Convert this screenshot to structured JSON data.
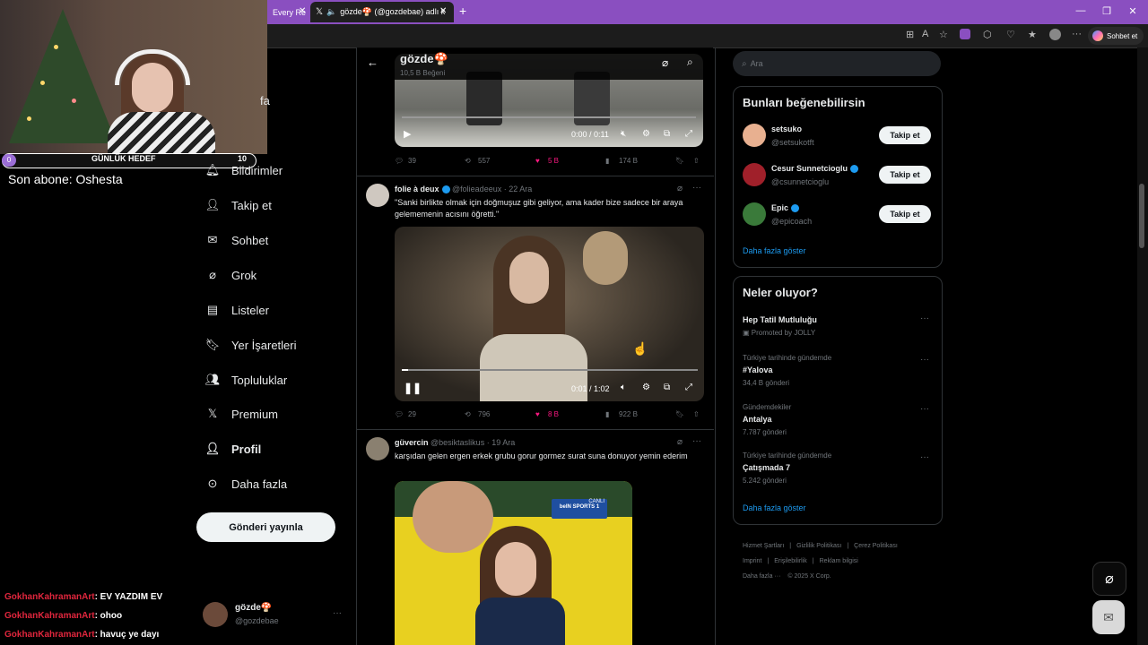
{
  "browser": {
    "tabs": [
      {
        "label": "Every Re"
      },
      {
        "label": "gözde🍄 (@gozdebae) adlı k"
      }
    ],
    "chat_label": "Sohbet et"
  },
  "stream": {
    "goal_title": "GÜNLÜK HEDEF",
    "goal_start": "0",
    "goal_target": "10",
    "last_sub": "Son abone: Oshesta",
    "chat": [
      {
        "user": "GokhanKahramanArt",
        "msg": ": EV YAZDIM EV"
      },
      {
        "user": "GokhanKahramanArt",
        "msg": ": ohoo"
      },
      {
        "user": "GokhanKahramanArt",
        "msg": ": havuç ye dayı"
      }
    ]
  },
  "nav": {
    "items": [
      {
        "label": "fa"
      },
      {
        "label": "Bildirimler"
      },
      {
        "label": "Takip et"
      },
      {
        "label": "Sohbet"
      },
      {
        "label": "Grok"
      },
      {
        "label": "Listeler"
      },
      {
        "label": "Yer İşaretleri"
      },
      {
        "label": "Topluluklar"
      },
      {
        "label": "Premium"
      },
      {
        "label": "Profil"
      },
      {
        "label": "Daha fazla"
      }
    ],
    "post_button": "Gönderi yayınla",
    "account_name": "gözde🍄",
    "account_handle": "@gozdebae"
  },
  "header": {
    "title": "gözde🍄",
    "subtitle": "10,5 B Beğeni"
  },
  "posts": [
    {
      "video_time": "0:00 / 0:11",
      "replies": "39",
      "reposts": "557",
      "likes": "5 B",
      "views": "174 B"
    },
    {
      "author": "folie à deux",
      "handle": "@folieadeeux",
      "date": "· 22 Ara",
      "text": "\"Sanki birlikte olmak için doğmuşuz gibi geliyor, ama kader bize sadece bir araya gelememenin acısını öğretti.\"",
      "video_time": "0:01 / 1:02",
      "video_progress": 0.02,
      "replies": "29",
      "reposts": "796",
      "likes": "8 B",
      "views": "922 B"
    },
    {
      "author": "güvercin",
      "handle": "@besiktaslikus",
      "date": "· 19 Ara",
      "text": "karşıdan gelen ergen erkek grubu gorur gormez surat suna donuyor yemin ederim",
      "badge_live": "CANLI",
      "badge_channel": "beIN SPORTS 1"
    }
  ],
  "sidebar": {
    "search_placeholder": "Ara",
    "suggest_title": "Bunları beğenebilirsin",
    "suggestions": [
      {
        "name": "setsuko",
        "handle": "@setsukotft",
        "button": "Takip et"
      },
      {
        "name": "Cesur Sunnetcioglu",
        "handle": "@csunnetcioglu",
        "button": "Takip et"
      },
      {
        "name": "Epic",
        "handle": "@epicoach",
        "button": "Takip et"
      }
    ],
    "show_more": "Daha fazla göster",
    "trends_title": "Neler oluyor?",
    "trends": [
      {
        "meta": "",
        "name": "Hep Tatil Mutluluğu",
        "sub": "Promoted by JOLLY"
      },
      {
        "meta": "Türkiye tarihinde gündemde",
        "name": "#Yalova",
        "sub": "34,4 B gönderi"
      },
      {
        "meta": "Gündemdekiler",
        "name": "Antalya",
        "sub": "7.787 gönderi"
      },
      {
        "meta": "Türkiye tarihinde gündemde",
        "name": "Çatışmada 7",
        "sub": "5.242 gönderi"
      }
    ],
    "trends_more": "Daha fazla göster",
    "footer": [
      "Hizmet Şartları",
      "Gizlilik Politikası",
      "Çerez Politikası",
      "Imprint",
      "Erişilebilirlik",
      "Reklam bilgisi",
      "Daha fazla ···",
      "© 2025 X Corp."
    ]
  },
  "colors": {
    "accent": "#1d9bf0",
    "like": "#f91880",
    "tabbar": "#8a4fc0"
  }
}
